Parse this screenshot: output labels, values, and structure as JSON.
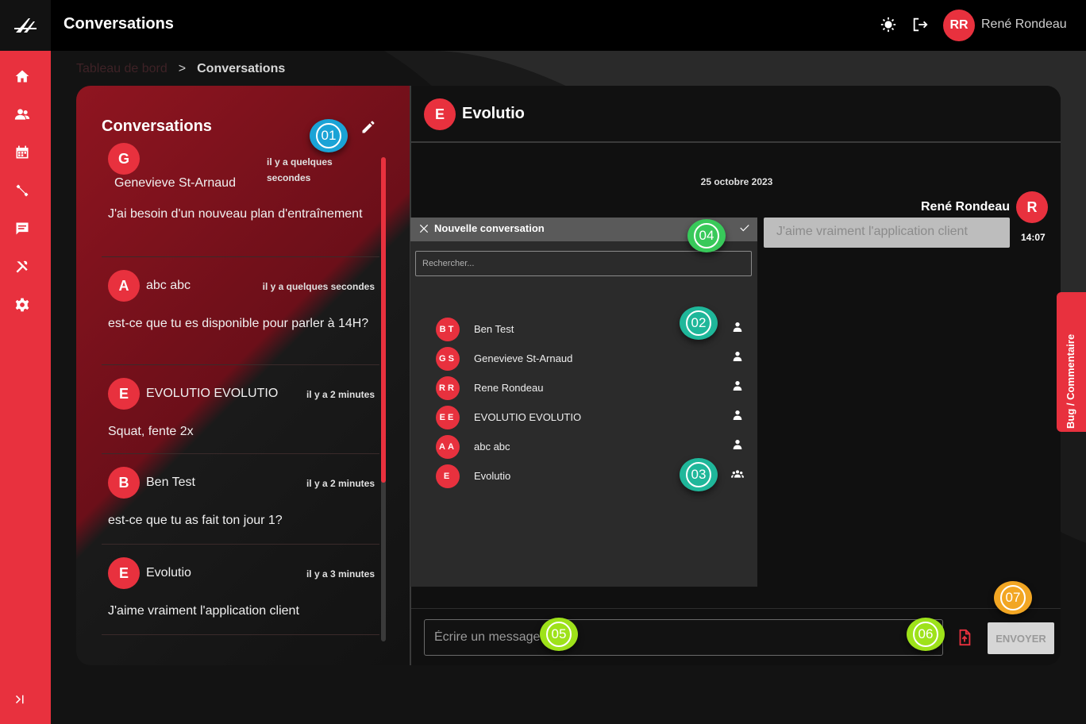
{
  "topbar": {
    "title": "Conversations",
    "user_initials": "RR",
    "user_name": "René Rondeau"
  },
  "breadcrumb": {
    "home": "Tableau de bord",
    "separator": ">",
    "current": "Conversations"
  },
  "conversations": {
    "title": "Conversations",
    "items": [
      {
        "initial": "G",
        "name": "Genevieve St-Arnaud",
        "time": "il y a quelques secondes",
        "message": "J'ai besoin d'un nouveau plan d'entraînement"
      },
      {
        "initial": "A",
        "name": "abc abc",
        "time": "il y a quelques secondes",
        "message": "est-ce que tu es disponible pour parler à 14H?"
      },
      {
        "initial": "E",
        "name": "EVOLUTIO EVOLUTIO",
        "time": "il y a 2 minutes",
        "message": "Squat, fente 2x"
      },
      {
        "initial": "B",
        "name": "Ben Test",
        "time": "il y a 2 minutes",
        "message": "est-ce que tu as fait ton jour 1?"
      },
      {
        "initial": "E",
        "name": "Evolutio",
        "time": "il y a 3 minutes",
        "message": "J'aime vraiment l'application client"
      }
    ]
  },
  "chat": {
    "avatar": "E",
    "name": "Evolutio",
    "date": "25 octobre 2023",
    "sender_name": "René Rondeau",
    "sender_initial": "R",
    "message": "J'aime vraiment l'application client",
    "message_time": "14:07",
    "input_placeholder": "Écrire un message",
    "send_label": "ENVOYER"
  },
  "modal": {
    "title": "Nouvelle conversation",
    "search_placeholder": "Rechercher...",
    "contacts": [
      {
        "initials": "BT",
        "name": "Ben Test",
        "type": "user"
      },
      {
        "initials": "GS",
        "name": "Genevieve St-Arnaud",
        "type": "user"
      },
      {
        "initials": "RR",
        "name": "Rene Rondeau",
        "type": "user"
      },
      {
        "initials": "EE",
        "name": "EVOLUTIO EVOLUTIO",
        "type": "user"
      },
      {
        "initials": "AA",
        "name": "abc abc",
        "type": "user"
      },
      {
        "initials": "E",
        "name": "Evolutio",
        "type": "group"
      }
    ]
  },
  "markers": [
    "01",
    "02",
    "03",
    "04",
    "05",
    "06",
    "07"
  ],
  "bug_tab": "Bug / Commentaire",
  "colors": {
    "accent": "#e8313e",
    "marker_blue": "#1aa3d6",
    "marker_teal": "#1fb79a",
    "marker_green": "#38c95a",
    "marker_lime": "#9ee21a",
    "marker_orange": "#f2a623"
  }
}
